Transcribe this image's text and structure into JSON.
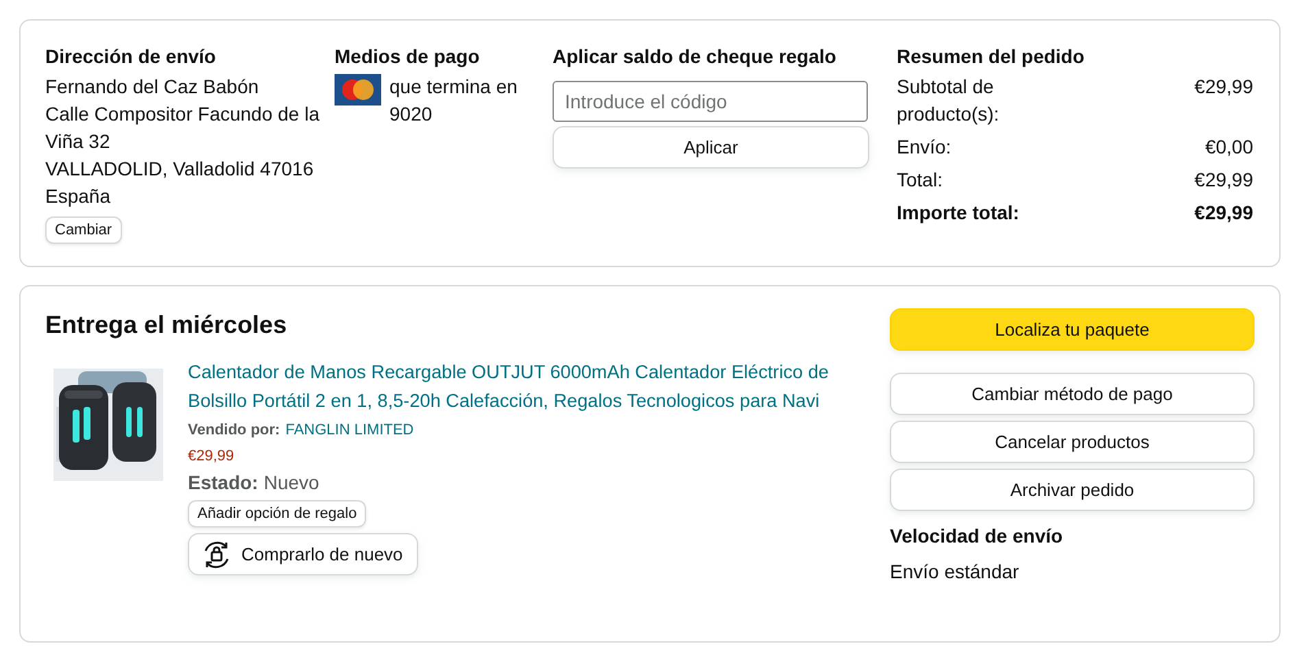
{
  "shipping_address": {
    "heading": "Dirección de envío",
    "lines": [
      "Fernando del Caz Babón",
      "Calle Compositor Facundo de la Viña 32",
      "VALLADOLID, Valladolid 47016",
      "España"
    ],
    "button": "Cambiar"
  },
  "payment": {
    "heading": "Medios de pago",
    "text": "que termina en 9020"
  },
  "gift_card": {
    "heading": "Aplicar saldo de cheque regalo",
    "placeholder": "Introduce el código",
    "button": "Aplicar"
  },
  "summary": {
    "heading": "Resumen del pedido",
    "rows": [
      {
        "label": "Subtotal de producto(s):",
        "value": "€29,99",
        "bold": false
      },
      {
        "label": "Envío:",
        "value": "€0,00",
        "bold": false
      },
      {
        "label": "Total:",
        "value": "€29,99",
        "bold": false
      },
      {
        "label": "Importe total:",
        "value": "€29,99",
        "bold": true
      }
    ]
  },
  "delivery": {
    "heading": "Entrega el miércoles",
    "item": {
      "title": "Calentador de Manos Recargable OUTJUT 6000mAh Calentador Eléctrico de Bolsillo Portátil 2 en 1, 8,5-20h Calefacción, Regalos Tecnologicos para Navi",
      "seller_label": "Vendido por:",
      "seller": "FANGLIN LIMITED",
      "price": "€29,99",
      "condition_label": "Estado:",
      "condition": "Nuevo",
      "gift_button": "Añadir opción de regalo",
      "rebuy_button": "Comprarlo de nuevo"
    },
    "actions": [
      {
        "label": "Localiza tu paquete",
        "kind": "primary"
      },
      {
        "label": "Cambiar método de pago",
        "kind": "secondary"
      },
      {
        "label": "Cancelar productos",
        "kind": "secondary"
      },
      {
        "label": "Archivar pedido",
        "kind": "secondary"
      }
    ],
    "shipping_speed": {
      "heading": "Velocidad de envío",
      "value": "Envío estándar"
    }
  }
}
